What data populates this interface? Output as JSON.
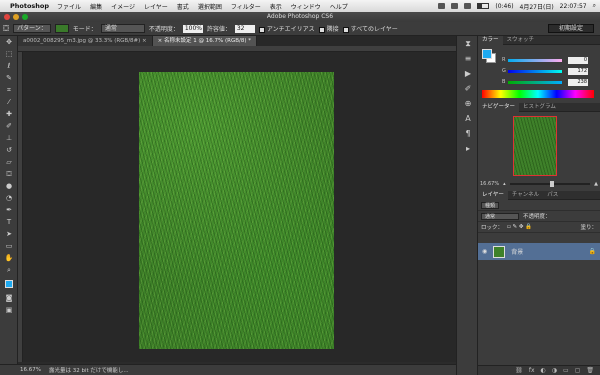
{
  "menubar": {
    "app_name": "Photoshop",
    "items": [
      "ファイル",
      "編集",
      "イメージ",
      "レイヤー",
      "書式",
      "選択範囲",
      "フィルター",
      "表示",
      "ウィンドウ",
      "ヘルプ"
    ],
    "battery": "(0:46)",
    "date": "4月27日(日)",
    "time": "22:07:57"
  },
  "window": {
    "title": "Adobe Photoshop CS6"
  },
  "options": {
    "pattern_label": "パターン：",
    "mode_label": "モード：",
    "mode_value": "通常",
    "opacity_label": "不透明度：",
    "opacity_value": "100%",
    "tolerance_label": "許容値：",
    "tolerance_value": "32",
    "antialias_label": "アンチエイリアス",
    "contiguous_label": "隣接",
    "all_layers_label": "すべてのレイヤー",
    "workspace_label": "初期設定"
  },
  "tabs": [
    {
      "label": "a0002_008295_m3.jpg @ 33.3% (RGB/8#) ×",
      "active": false
    },
    {
      "label": "× 名称未設定 1 @ 16.7% (RGB/8) *",
      "active": true
    }
  ],
  "status": {
    "zoom": "16.67%",
    "message": "露光量は 32 bit だけで機能し..."
  },
  "color_panel": {
    "tabs": [
      "カラー",
      "スウォッチ"
    ],
    "channels": [
      {
        "label": "R",
        "value": "0"
      },
      {
        "label": "G",
        "value": "172"
      },
      {
        "label": "B",
        "value": "238"
      }
    ],
    "foreground": "#1eaaf1",
    "background": "#ffffff"
  },
  "navigator": {
    "tabs": [
      "ナビゲーター",
      "ヒストグラム"
    ],
    "zoom": "16.67%"
  },
  "layers": {
    "tabs": [
      "レイヤー",
      "チャンネル",
      "パス"
    ],
    "filter_label": "種類",
    "blend_mode": "通常",
    "opacity_label": "不透明度：",
    "lock_label": "ロック：",
    "fill_label": "塗り：",
    "layer_name": "背景"
  },
  "icons": {
    "tools": [
      "move-icon",
      "marquee-icon",
      "lasso-icon",
      "quick-select-icon",
      "crop-icon",
      "eyedropper-icon",
      "healing-icon",
      "brush-icon",
      "stamp-icon",
      "history-brush-icon",
      "eraser-icon",
      "bucket-icon",
      "blur-icon",
      "dodge-icon",
      "pen-icon",
      "type-icon",
      "path-select-icon",
      "shape-icon",
      "hand-icon",
      "zoom-icon"
    ]
  }
}
